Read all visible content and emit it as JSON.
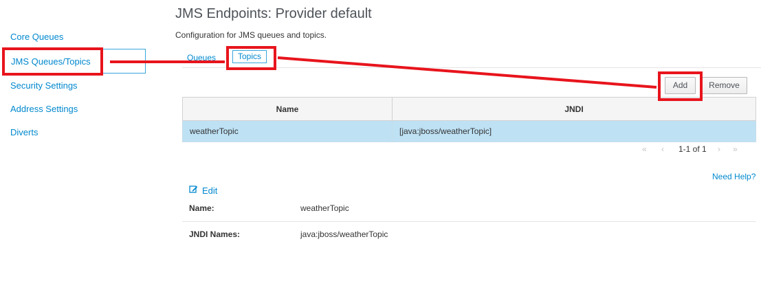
{
  "sidebar": {
    "items": [
      {
        "label": "Core Queues"
      },
      {
        "label": "JMS Queues/Topics",
        "selected": true
      },
      {
        "label": "Security Settings"
      },
      {
        "label": "Address Settings"
      },
      {
        "label": "Diverts"
      }
    ]
  },
  "header": {
    "title": "JMS Endpoints: Provider default",
    "description": "Configuration for JMS queues and topics."
  },
  "tabs": [
    {
      "label": "Queues"
    },
    {
      "label": "Topics",
      "active": true
    }
  ],
  "toolbar": {
    "add_label": "Add",
    "remove_label": "Remove"
  },
  "table": {
    "columns": [
      "Name",
      "JNDI"
    ],
    "rows": [
      {
        "name": "weatherTopic",
        "jndi": "[java:jboss/weatherTopic]",
        "selected": true
      }
    ]
  },
  "pager": {
    "text": "1-1 of 1",
    "first": "«",
    "prev": "‹",
    "next": "›",
    "last": "»"
  },
  "help": {
    "label": "Need Help?"
  },
  "detail": {
    "edit_label": "Edit",
    "fields": [
      {
        "label": "Name:",
        "value": "weatherTopic"
      },
      {
        "label": "JNDI Names:",
        "value": "java:jboss/weatherTopic"
      }
    ]
  },
  "colors": {
    "link": "#0088ce",
    "selected_row": "#bee1f4",
    "annotation": "#e8141c"
  }
}
